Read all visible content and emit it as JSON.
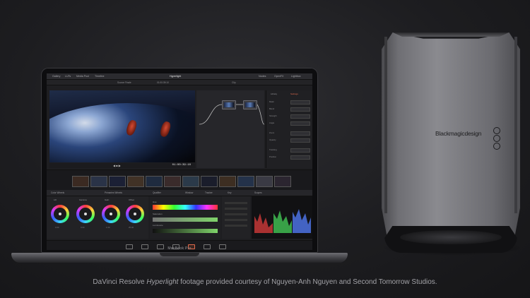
{
  "app": {
    "window_title": "Hyperlight",
    "menu": [
      "Gallery",
      "LUTs",
      "Media Pool",
      "Timeline"
    ],
    "toolbar_right": [
      "Nodes",
      "OpenFX",
      "Lightbox"
    ],
    "timeline_name": "Source Finale",
    "timecode": "01:00:39:10",
    "clip_label": "Clip",
    "inspector_tabs": [
      "Library",
      "Settings"
    ],
    "inspector_rows": [
      "Mask",
      "Blend",
      "Strength",
      "Angle",
      "Zoom",
      "Opacity",
      "Tracking",
      "Position"
    ],
    "tools": [
      "Color Wheels",
      "Primaries Wheels",
      "Qualifier",
      "Window",
      "Tracker",
      "Key",
      "Scopes"
    ],
    "wheel_names": [
      "Lift",
      "Gamma",
      "Gain",
      "Offset"
    ],
    "wheel_values": [
      "0.00",
      "0.00",
      "1.00",
      "25.00"
    ],
    "qualifier_labels": [
      "Hue",
      "Saturation",
      "Luminance"
    ],
    "page_tabs": [
      "Media",
      "Cut",
      "Edit",
      "Fusion",
      "Color",
      "Fairlight",
      "Deliver"
    ],
    "active_page": "Color"
  },
  "device": {
    "laptop_label": "MacBook Pro",
    "egpu_brand": "Blackmagicdesign"
  },
  "caption": {
    "pre": "DaVinci Resolve ",
    "italic": "Hyperlight",
    "post": " footage provided courtesy of Nguyen-Anh Nguyen and Second Tomorrow Studios."
  },
  "colors": {
    "accent": "#e36b4c",
    "background": "#1d1d20",
    "egpu_body": "#8a8a8f"
  }
}
